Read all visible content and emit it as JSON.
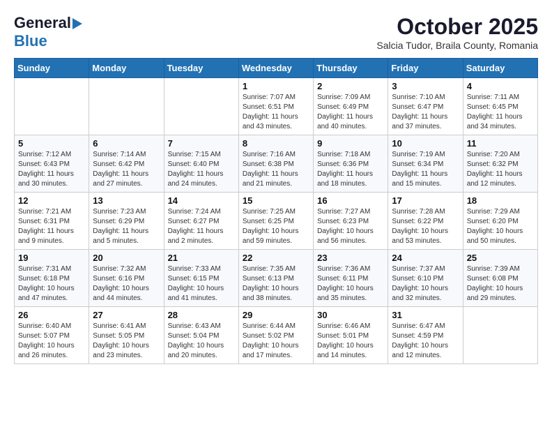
{
  "header": {
    "logo_general": "General",
    "logo_blue": "Blue",
    "month_title": "October 2025",
    "subtitle": "Salcia Tudor, Braila County, Romania"
  },
  "calendar": {
    "days_of_week": [
      "Sunday",
      "Monday",
      "Tuesday",
      "Wednesday",
      "Thursday",
      "Friday",
      "Saturday"
    ],
    "weeks": [
      [
        {
          "day": "",
          "info": ""
        },
        {
          "day": "",
          "info": ""
        },
        {
          "day": "",
          "info": ""
        },
        {
          "day": "1",
          "info": "Sunrise: 7:07 AM\nSunset: 6:51 PM\nDaylight: 11 hours\nand 43 minutes."
        },
        {
          "day": "2",
          "info": "Sunrise: 7:09 AM\nSunset: 6:49 PM\nDaylight: 11 hours\nand 40 minutes."
        },
        {
          "day": "3",
          "info": "Sunrise: 7:10 AM\nSunset: 6:47 PM\nDaylight: 11 hours\nand 37 minutes."
        },
        {
          "day": "4",
          "info": "Sunrise: 7:11 AM\nSunset: 6:45 PM\nDaylight: 11 hours\nand 34 minutes."
        }
      ],
      [
        {
          "day": "5",
          "info": "Sunrise: 7:12 AM\nSunset: 6:43 PM\nDaylight: 11 hours\nand 30 minutes."
        },
        {
          "day": "6",
          "info": "Sunrise: 7:14 AM\nSunset: 6:42 PM\nDaylight: 11 hours\nand 27 minutes."
        },
        {
          "day": "7",
          "info": "Sunrise: 7:15 AM\nSunset: 6:40 PM\nDaylight: 11 hours\nand 24 minutes."
        },
        {
          "day": "8",
          "info": "Sunrise: 7:16 AM\nSunset: 6:38 PM\nDaylight: 11 hours\nand 21 minutes."
        },
        {
          "day": "9",
          "info": "Sunrise: 7:18 AM\nSunset: 6:36 PM\nDaylight: 11 hours\nand 18 minutes."
        },
        {
          "day": "10",
          "info": "Sunrise: 7:19 AM\nSunset: 6:34 PM\nDaylight: 11 hours\nand 15 minutes."
        },
        {
          "day": "11",
          "info": "Sunrise: 7:20 AM\nSunset: 6:32 PM\nDaylight: 11 hours\nand 12 minutes."
        }
      ],
      [
        {
          "day": "12",
          "info": "Sunrise: 7:21 AM\nSunset: 6:31 PM\nDaylight: 11 hours\nand 9 minutes."
        },
        {
          "day": "13",
          "info": "Sunrise: 7:23 AM\nSunset: 6:29 PM\nDaylight: 11 hours\nand 5 minutes."
        },
        {
          "day": "14",
          "info": "Sunrise: 7:24 AM\nSunset: 6:27 PM\nDaylight: 11 hours\nand 2 minutes."
        },
        {
          "day": "15",
          "info": "Sunrise: 7:25 AM\nSunset: 6:25 PM\nDaylight: 10 hours\nand 59 minutes."
        },
        {
          "day": "16",
          "info": "Sunrise: 7:27 AM\nSunset: 6:23 PM\nDaylight: 10 hours\nand 56 minutes."
        },
        {
          "day": "17",
          "info": "Sunrise: 7:28 AM\nSunset: 6:22 PM\nDaylight: 10 hours\nand 53 minutes."
        },
        {
          "day": "18",
          "info": "Sunrise: 7:29 AM\nSunset: 6:20 PM\nDaylight: 10 hours\nand 50 minutes."
        }
      ],
      [
        {
          "day": "19",
          "info": "Sunrise: 7:31 AM\nSunset: 6:18 PM\nDaylight: 10 hours\nand 47 minutes."
        },
        {
          "day": "20",
          "info": "Sunrise: 7:32 AM\nSunset: 6:16 PM\nDaylight: 10 hours\nand 44 minutes."
        },
        {
          "day": "21",
          "info": "Sunrise: 7:33 AM\nSunset: 6:15 PM\nDaylight: 10 hours\nand 41 minutes."
        },
        {
          "day": "22",
          "info": "Sunrise: 7:35 AM\nSunset: 6:13 PM\nDaylight: 10 hours\nand 38 minutes."
        },
        {
          "day": "23",
          "info": "Sunrise: 7:36 AM\nSunset: 6:11 PM\nDaylight: 10 hours\nand 35 minutes."
        },
        {
          "day": "24",
          "info": "Sunrise: 7:37 AM\nSunset: 6:10 PM\nDaylight: 10 hours\nand 32 minutes."
        },
        {
          "day": "25",
          "info": "Sunrise: 7:39 AM\nSunset: 6:08 PM\nDaylight: 10 hours\nand 29 minutes."
        }
      ],
      [
        {
          "day": "26",
          "info": "Sunrise: 6:40 AM\nSunset: 5:07 PM\nDaylight: 10 hours\nand 26 minutes."
        },
        {
          "day": "27",
          "info": "Sunrise: 6:41 AM\nSunset: 5:05 PM\nDaylight: 10 hours\nand 23 minutes."
        },
        {
          "day": "28",
          "info": "Sunrise: 6:43 AM\nSunset: 5:04 PM\nDaylight: 10 hours\nand 20 minutes."
        },
        {
          "day": "29",
          "info": "Sunrise: 6:44 AM\nSunset: 5:02 PM\nDaylight: 10 hours\nand 17 minutes."
        },
        {
          "day": "30",
          "info": "Sunrise: 6:46 AM\nSunset: 5:01 PM\nDaylight: 10 hours\nand 14 minutes."
        },
        {
          "day": "31",
          "info": "Sunrise: 6:47 AM\nSunset: 4:59 PM\nDaylight: 10 hours\nand 12 minutes."
        },
        {
          "day": "",
          "info": ""
        }
      ]
    ]
  }
}
